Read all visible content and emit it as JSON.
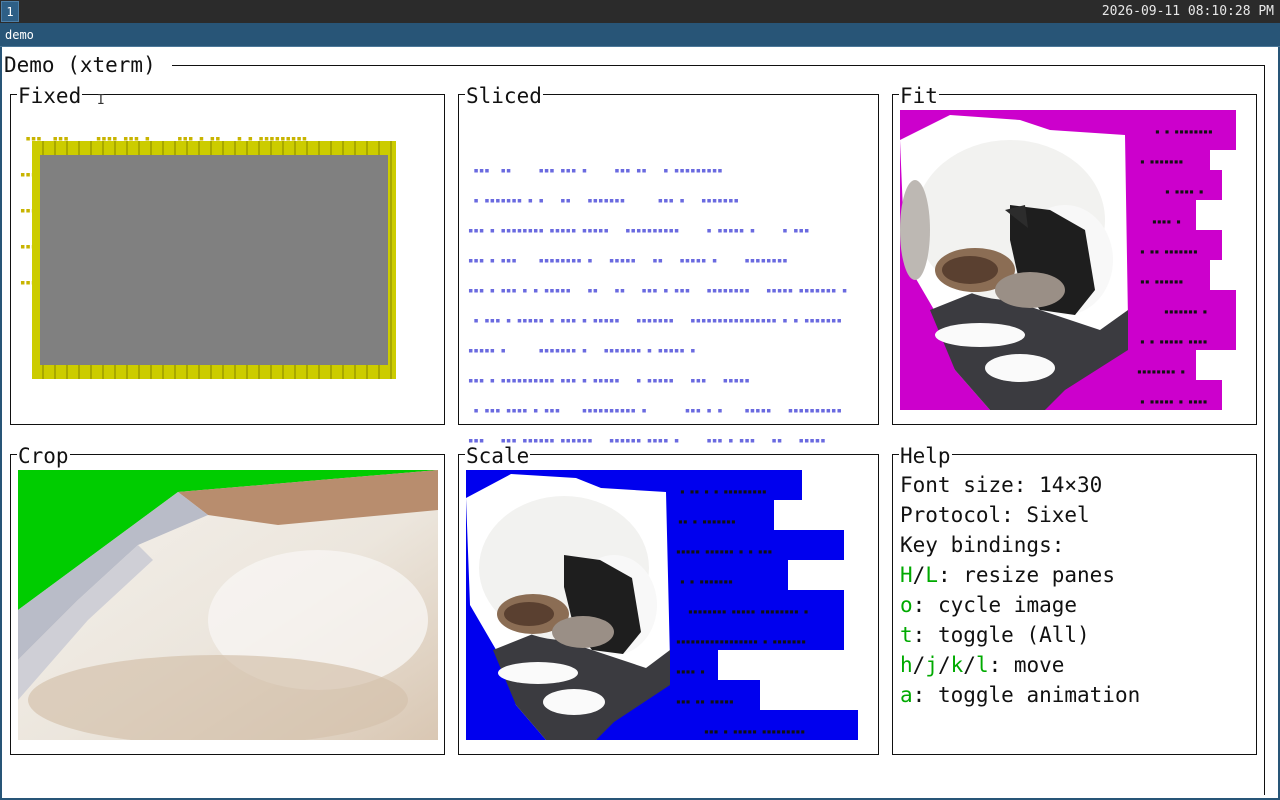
{
  "topbar": {
    "workspace": "1",
    "clock": "2026-09-11 08:10:28 PM"
  },
  "window": {
    "title": "demo"
  },
  "app": {
    "title": "Demo (xterm)"
  },
  "panes": {
    "fixed": {
      "title": "Fixed"
    },
    "sliced": {
      "title": "Sliced"
    },
    "fit": {
      "title": "Fit"
    },
    "crop": {
      "title": "Crop"
    },
    "scale": {
      "title": "Scale"
    },
    "help": {
      "title": "Help"
    }
  },
  "help": {
    "font_size": "Font size: 14×30",
    "protocol": "Protocol: Sixel",
    "key_bindings": "Key bindings:",
    "resize_keys": [
      "H",
      "L"
    ],
    "resize_text": ": resize panes",
    "cycle_key": "o",
    "cycle_text": ": cycle image",
    "toggle_key": "t",
    "toggle_text": ": toggle (All)",
    "move_keys": [
      "h",
      "j",
      "k",
      "l"
    ],
    "move_text": ": move",
    "anim_key": "a",
    "anim_text": ": toggle animation"
  },
  "colors": {
    "accent": "#285577",
    "fixed_frame": "#cccc00",
    "fixed_fill": "#808080",
    "fit_bg": "#cc00cc",
    "crop_bg": "#00cc00",
    "scale_bg": "#0000ee",
    "sliced_dots": "#6a6ae0",
    "key": "#00aa00"
  }
}
